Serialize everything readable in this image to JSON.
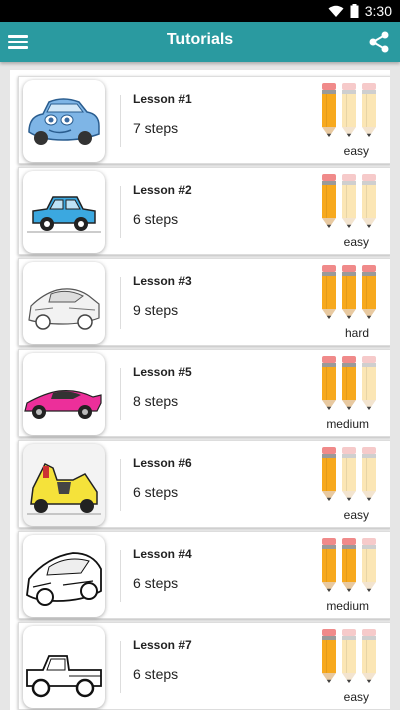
{
  "status": {
    "time": "3:30"
  },
  "appbar": {
    "title": "Tutorials",
    "menu_icon": "hamburger-menu-icon",
    "share_icon": "share-icon"
  },
  "colors": {
    "appbar": "#2a9aa0",
    "pencil_active": "#f7a91e",
    "pencil_inactive": "#fbe6b5"
  },
  "lessons": [
    {
      "title": "Lesson #1",
      "steps": "7 steps",
      "difficulty": "easy",
      "rating": 1,
      "image": "blue-cartoon-car"
    },
    {
      "title": "Lesson #2",
      "steps": "6 steps",
      "difficulty": "easy",
      "rating": 1,
      "image": "blue-simple-car"
    },
    {
      "title": "Lesson #3",
      "steps": "9 steps",
      "difficulty": "hard",
      "rating": 3,
      "image": "sketch-sports-car"
    },
    {
      "title": "Lesson #5",
      "steps": "8 steps",
      "difficulty": "medium",
      "rating": 2,
      "image": "pink-sports-car"
    },
    {
      "title": "Lesson #6",
      "steps": "6 steps",
      "difficulty": "easy",
      "rating": 1,
      "image": "yellow-race-car"
    },
    {
      "title": "Lesson #4",
      "steps": "6 steps",
      "difficulty": "medium",
      "rating": 2,
      "image": "outline-supercar"
    },
    {
      "title": "Lesson #7",
      "steps": "6 steps",
      "difficulty": "easy",
      "rating": 1,
      "image": "pickup-truck"
    }
  ]
}
